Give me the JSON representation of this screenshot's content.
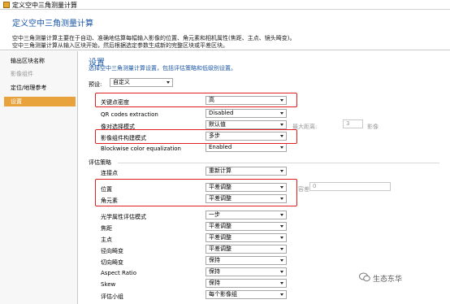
{
  "window": {
    "title": "定义空中三角测量计算"
  },
  "header": {
    "title": "定义空中三角测量计算",
    "desc1": "空中三角测量计算主要在于自动、准确地估算每幅输入影像的位置、角元素和相机属性(焦距、主点、镜头畸变)。",
    "desc2": "空中三角测量计算从输入区块开始，然后根据选定参数生成新的完整区块或平差区块。"
  },
  "sidebar": {
    "items": [
      {
        "label": "输出区块名称"
      },
      {
        "label": "影像组件"
      },
      {
        "label": "定位/地理参考"
      },
      {
        "label": "设置"
      }
    ]
  },
  "main": {
    "title": "设置",
    "subtitle": "选择空中三角测量计算设置，包括评估策略和低级别设置。",
    "preset_label": "预设:",
    "preset_value": "自定义",
    "rows": [
      {
        "label": "关键点密度",
        "value": "高"
      },
      {
        "label": "QR codes extraction",
        "value": "Disabled"
      },
      {
        "label": "像对选择模式",
        "value": "默认值"
      },
      {
        "label": "影像组件构建模式",
        "value": "多步"
      },
      {
        "label": "Blockwise color equalization",
        "value": "Enabled"
      }
    ],
    "max_distance_label": "最大距离:",
    "max_distance_value": "3",
    "max_distance_unit": "影像",
    "strategy_title": "评估策略",
    "tie_points_label": "连接点",
    "tie_points_value": "重新计算",
    "position_label": "位置",
    "position_value": "平差调整",
    "tolerance_label": "容差",
    "tolerance_value": "0",
    "rotation_label": "角元素",
    "rotation_value": "平差调整",
    "optical_rows": [
      {
        "label": "光学属性评估模式",
        "value": "一步"
      },
      {
        "label": "焦距",
        "value": "平差调整"
      },
      {
        "label": "主点",
        "value": "平差调整"
      },
      {
        "label": "径向畸变",
        "value": "平差调整"
      },
      {
        "label": "切向畸变",
        "value": "保持"
      },
      {
        "label": "Aspect Ratio",
        "value": "保持"
      },
      {
        "label": "Skew",
        "value": "保持"
      },
      {
        "label": "评估小组",
        "value": "每个影像组"
      }
    ]
  },
  "watermark": {
    "text": "生态东华",
    "icon": "wechat-icon"
  },
  "colors": {
    "accent": "#e8a33d",
    "title_blue": "#1a56a6",
    "highlight_red": "#e02020"
  }
}
